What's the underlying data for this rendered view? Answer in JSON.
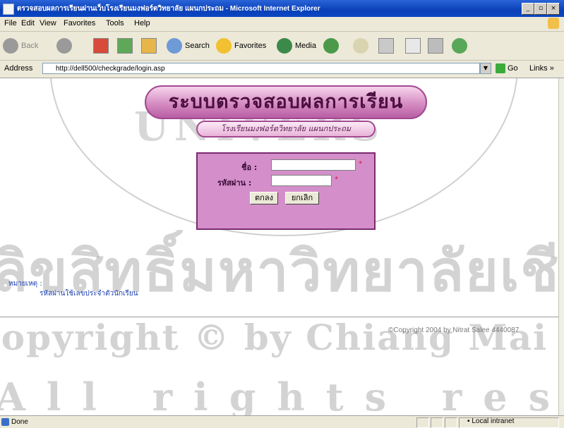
{
  "window": {
    "title": "ตรวจสอบผลการเรียนผ่านเว็บโรงเรียนมงฟอร์ตวิทยาลัย แผนกประถม - Microsoft Internet Explorer"
  },
  "menu": [
    "File",
    "Edit",
    "View",
    "Favorites",
    "Tools",
    "Help"
  ],
  "toolbar": {
    "back": "Back",
    "search": "Search",
    "favorites": "Favorites",
    "media": "Media"
  },
  "address": {
    "label": "Address",
    "url": "http://dell500/checkgrade/login.asp",
    "go": "Go",
    "links": "Links"
  },
  "page": {
    "banner_title": "ระบบตรวจสอบผลการเรียน",
    "banner_subtitle": "โรงเรียนมงฟอร์ตวิทยาลัย แผนกประถม",
    "login": {
      "name_label": "ชื่อ :",
      "password_label": "รหัสผ่าน :",
      "name_value": "",
      "password_value": "",
      "required_mark": "*",
      "ok_button": "ตกลง",
      "cancel_button": "ยกเลิก"
    },
    "note_label": "หมายเหตุ :",
    "note_text": "รหัสผ่านใช้เลขประจำตัวนักเรียน",
    "copyright": "©Copyright 2004 by Nitrat Salee 4440087"
  },
  "watermark": {
    "arc_text": "UNIVERS",
    "thai": "ลิขสิทธิ์มหาวิทยาลัยเชียงใหม่",
    "english": "Copyright © by Chiang Mai University",
    "rights": "All rights reserved"
  },
  "status": {
    "text": "Done",
    "zone": "Local intranet"
  }
}
